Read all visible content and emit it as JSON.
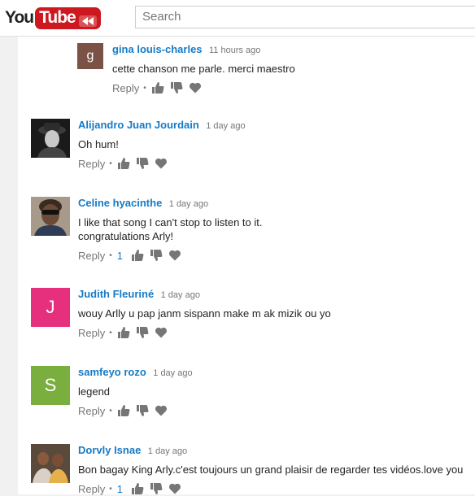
{
  "header": {
    "logo_you": "You",
    "logo_tube": "Tube",
    "search_placeholder": "Search"
  },
  "colors": {
    "brand_red": "#cc181e",
    "author_blue": "#167ac6"
  },
  "comments": [
    {
      "author": "gina louis-charles",
      "time": "11 hours ago",
      "text": "cette chanson me parle. merci maestro",
      "avatar_letter": "g",
      "avatar_color": "#7b5246",
      "reply_label": "Reply",
      "like_count": null
    },
    {
      "author": "Alijandro Juan Jourdain",
      "time": "1 day ago",
      "text": "Oh hum!",
      "avatar_letter": "",
      "avatar_icon": "photo-avatar-dark",
      "reply_label": "Reply",
      "like_count": null
    },
    {
      "author": "Celine hyacinthe",
      "time": "1 day ago",
      "text": "I like that song I can't stop to listen to it.",
      "text2": "congratulations Arly!",
      "avatar_letter": "",
      "avatar_icon": "photo-avatar-woman",
      "reply_label": "Reply",
      "like_count": "1"
    },
    {
      "author": "Judith Fleuriné",
      "time": "1 day ago",
      "text": "wouy Arlly u pap janm sispann make m ak mizik ou yo",
      "avatar_letter": "J",
      "avatar_color": "#e62f7d",
      "reply_label": "Reply",
      "like_count": null
    },
    {
      "author": "samfeyo rozo",
      "time": "1 day ago",
      "text": "legend",
      "avatar_letter": "S",
      "avatar_color": "#7aae3f",
      "reply_label": "Reply",
      "like_count": null
    },
    {
      "author": "Dorvly Isnae",
      "time": "1 day ago",
      "text": "Bon bagay King Arly.c'est toujours un grand plaisir de regarder tes vidéos.love you",
      "avatar_letter": "",
      "avatar_icon": "photo-avatar-group",
      "reply_label": "Reply",
      "like_count": "1"
    }
  ],
  "icons": {
    "like": "thumbs-up-icon",
    "dislike": "thumbs-down-icon",
    "heart": "heart-icon"
  }
}
